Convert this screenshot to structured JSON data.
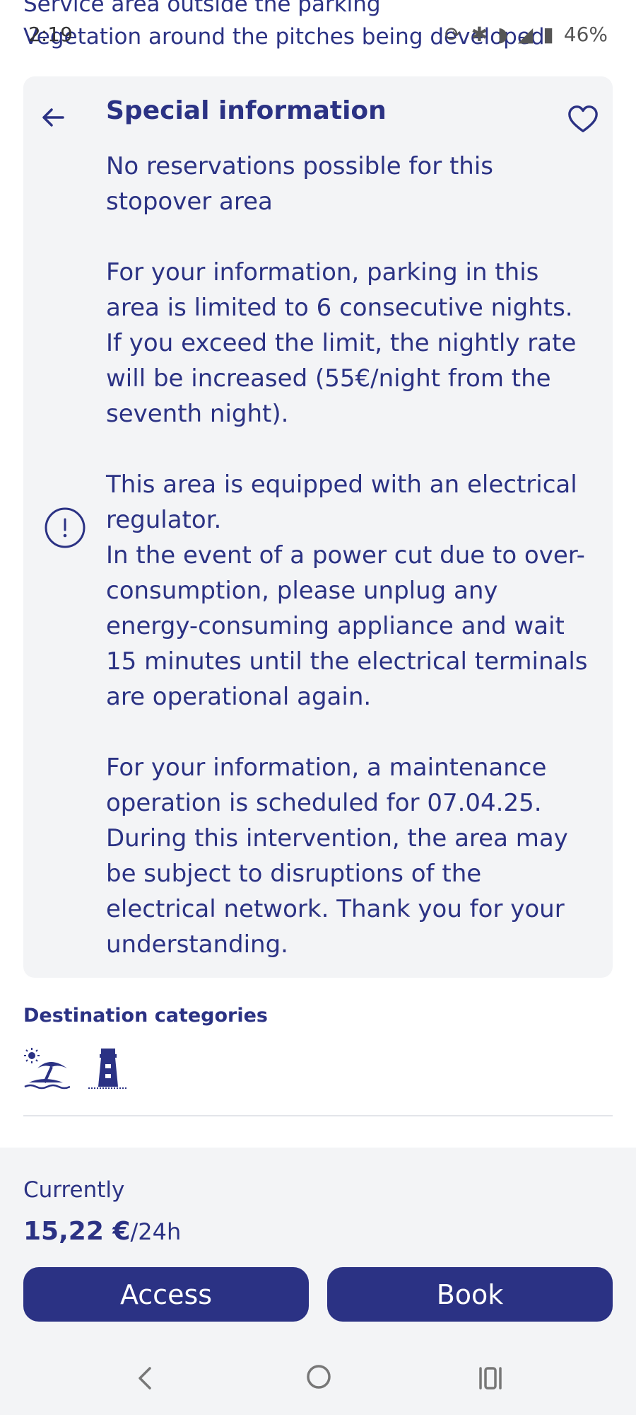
{
  "status_bar": {
    "time": "2:19",
    "battery": "46%"
  },
  "scrolled_text": {
    "line1": "Service area outside the parking",
    "line2": "Vegetation around the pitches being developed"
  },
  "special_info": {
    "title": "Special information",
    "paragraphs": [
      "No reservations possible for this stopover area",
      "For your information, parking in this area is limited to 6 consecutive nights. If you exceed the limit, the nightly rate will be increased (55€/night from the seventh night).",
      "This area is equipped with an electrical regulator.",
      "In the event of a power cut due to over-consumption, please unplug any energy-consuming appliance and wait 15 minutes until the electrical terminals are operational again.",
      "For your information, a maintenance operation is scheduled for 07.04.25. During this intervention, the area may be subject to disruptions of the electrical network. Thank you for your understanding."
    ]
  },
  "destination": {
    "title": "Destination categories",
    "icons": [
      "beach-icon",
      "lighthouse-icon"
    ]
  },
  "footer": {
    "currently_label": "Currently",
    "price": "15,22 €",
    "price_unit": "/24h",
    "access_label": "Access",
    "book_label": "Book"
  },
  "colors": {
    "primary": "#2b3284",
    "card_bg": "#f3f4f6"
  }
}
